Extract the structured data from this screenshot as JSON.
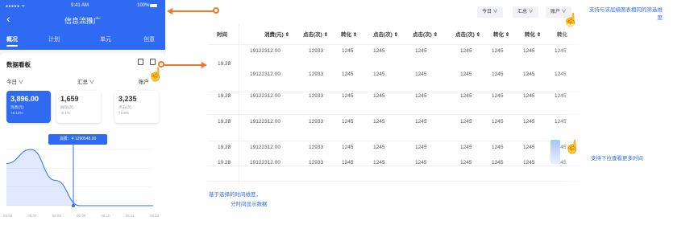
{
  "phone": {
    "status": {
      "signal": "●●●●● ᯤ",
      "time": "9:41 AM",
      "battery": "100%"
    },
    "back_glyph": "‹",
    "title": "信息流推广",
    "tabs": [
      {
        "label": "概况"
      },
      {
        "label": "计划"
      },
      {
        "label": "单元"
      },
      {
        "label": "创意"
      }
    ],
    "board": {
      "title": "数据看板",
      "filter_day": "今日 ∨",
      "filter_summary": "汇总 ∨",
      "filter_account": "账户"
    },
    "kpis": [
      {
        "value": "3,896.00",
        "label": "消费(元)",
        "change": "+5.12%"
      },
      {
        "value": "1,659",
        "label": "展现(次)",
        "change": "-5.1%"
      },
      {
        "value": "3,235",
        "label": "点击(次)",
        "change": "+2.6%"
      }
    ],
    "tooltip": "消费：¥ 1290548.00",
    "chart_data": {
      "type": "area",
      "x": [
        "06:06",
        "06:07",
        "06:08",
        "06:09",
        "06:10",
        "06:11",
        "06:12"
      ],
      "series": [
        {
          "values": [
            0.75,
            1.0,
            0.45,
            0,
            0,
            0,
            0
          ]
        }
      ],
      "highlight_index": 3,
      "color": "#2f6bf2"
    }
  },
  "table": {
    "toolbar": [
      "今日 ∨",
      "汇总 ∨",
      "账户 ∨"
    ],
    "headers": [
      "时间",
      "消费(元) ⇕",
      "点击(次) ⇕",
      "转化 ⇕",
      "点击(次) ⇕",
      "点击(次) ⇕",
      "点击(次) ⇕",
      "转化 ⇕",
      "转化 ⇕",
      "转化"
    ],
    "rows": [
      {
        "time": "19.28",
        "cells": [
          "19122312.00",
          "12933",
          "1245",
          "1245",
          "1245",
          "1245",
          "1245",
          "1245",
          "1245"
        ]
      },
      {
        "time": "",
        "cells": [
          "19122312.00",
          "12933",
          "1245",
          "1245",
          "1245",
          "1245",
          "1245",
          "1245",
          "1245"
        ]
      },
      {
        "time": "19.28",
        "cells": [
          "19122312.00",
          "12933",
          "1245",
          "1245",
          "1245",
          "1245",
          "1245",
          "1245",
          "1245"
        ]
      },
      {
        "time": "19.28",
        "cells": [
          "19122312.00",
          "12933",
          "1245",
          "1245",
          "1245",
          "1245",
          "1245",
          "1245",
          "1245"
        ]
      },
      {
        "time": "19.28",
        "cells": [
          "19122312.00",
          "12933",
          "1245",
          "1245",
          "1245",
          "1245",
          "1245",
          "1245",
          "1245"
        ]
      },
      {
        "time": "19.28",
        "cells": [
          "19122312.00",
          "12933",
          "1245",
          "1245",
          "1245",
          "1245",
          "1245",
          "1245",
          "1245"
        ]
      }
    ]
  },
  "annotations": {
    "filter_note": "支持与该层级图表相同的筛选维度",
    "scroll_note": "支持下拉查看更多时间",
    "time_note_line1": "基于选择的时间维度，",
    "time_note_line2": "分时间显示数据"
  },
  "icons": {
    "hand": "hand-pointer-icon",
    "arrow": "arrow-down-icon",
    "download": "download-icon",
    "export": "export-icon"
  }
}
